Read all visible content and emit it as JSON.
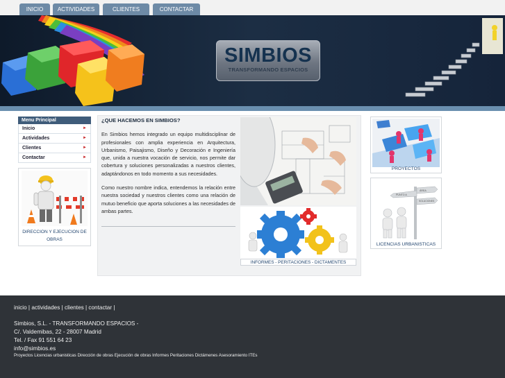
{
  "nav": {
    "tabs": [
      {
        "label": "INICIO"
      },
      {
        "label": "ACTIVIDADES"
      },
      {
        "label": "CLIENTES"
      },
      {
        "label": "CONTACTAR"
      }
    ]
  },
  "banner": {
    "logo_title": "SIMBIOS",
    "logo_subtitle": "TRANSFORMANDO ESPACIOS"
  },
  "menu": {
    "title": "Menu Principal",
    "items": [
      {
        "label": "Inicio"
      },
      {
        "label": "Actividades"
      },
      {
        "label": "Clientes"
      },
      {
        "label": "Contactar"
      }
    ],
    "arrow_glyph": "►"
  },
  "left_box": {
    "caption": "DIRECCION Y EJECUCION DE OBRAS"
  },
  "main": {
    "heading": "¿QUE HACEMOS EN SIMBIOS?",
    "paragraph1": "En Simbios hemos integrado un equipo multidisciplinar de profesionales con amplia experiencia en Arquitectura, Urbanismo, Paisajismo, Diseño y Decoración e Ingeniería que, unida a nuestra vocación de servicio, nos permite dar cobertura y soluciones personalizadas a nuestros clientes, adaptándonos en todo momento a sus necesidades.",
    "paragraph2": "Como nuestro nombre indica, entendemos la relación entre nuestra sociedad y nuestros clientes como una relación de mutuo beneficio que aporta soluciones a las necesidades de ambas partes.",
    "photo_caption": "INFORMES - PERITACIONES - DICTAMENTES"
  },
  "right": {
    "box1_caption": "PROYECTOS",
    "box2_caption": "LICENCIAS URBANISTICAS",
    "sign_labels": [
      "PUNTO A",
      "PUNTO B",
      "ÁREA",
      "SOLUCIONES"
    ]
  },
  "footer": {
    "links": "inicio | actividades | clientes | contactar |",
    "company": "Simbios, S.L. - TRANSFORMANDO ESPACIOS -",
    "address": "C/. Valdemibas, 22 - 28007 Madrid",
    "phone": "Tel. / Fax 91 551 64 23",
    "email": "info@simbios.es",
    "keywords": "Proyectos  Licencias urbanisticas Dirección de obras Ejecución de obras Informes Peritaciones Dictámenes Asesoramiento ITEs"
  },
  "colors": {
    "nav_tab": "#6d8aa6",
    "menu_header": "#3f5c7a",
    "caption_text": "#23466f",
    "footer_bg": "#2f3338",
    "banner_bg": "#142234"
  }
}
